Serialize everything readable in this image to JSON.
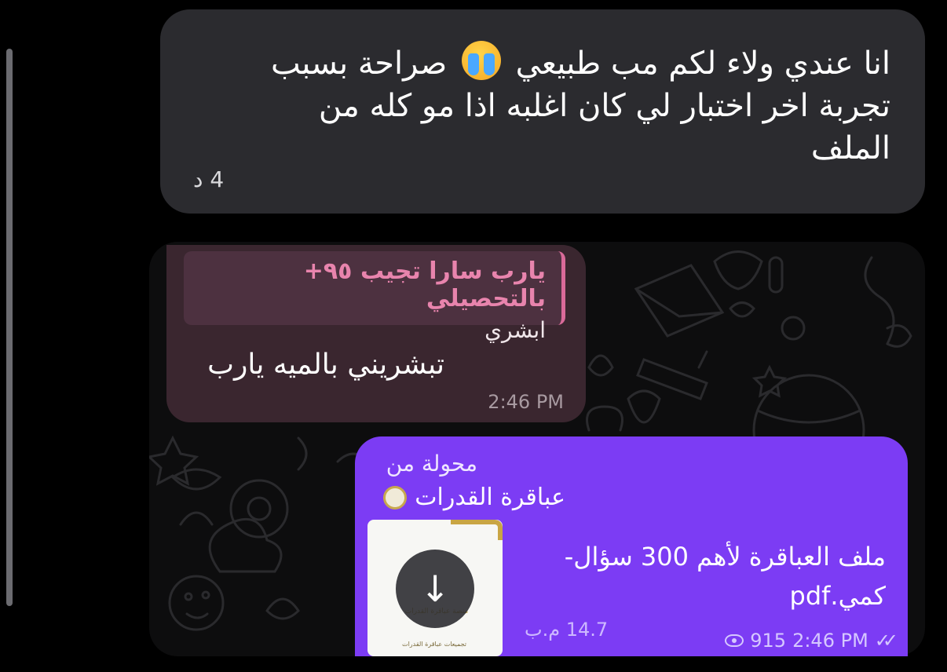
{
  "message_top": {
    "line1": "انا عندي ولاء لكم مب طبيعي",
    "line1_tail": "صراحة بسبب",
    "line2": "تجربة اخر اختبار لي كان اغلبه اذا مو كله من",
    "line3": "الملف",
    "emoji": "crying-face",
    "time": "4 د"
  },
  "reply_message": {
    "quote_title": "يارب سارا تجيب ٩٥+ بالتحصيلي",
    "quote_text": "ابشري",
    "text": "تبشريني بالميه يارب",
    "time": "2:46 PM",
    "accent": "#d96a99"
  },
  "forwarded_message": {
    "forward_label": "محولة من",
    "source_name": "عباقرة القدرات",
    "file_name": "ملف العباقرة لأهم 300 سؤال-كمي.pdf",
    "file_size": "14.7 م.ب",
    "views": "915",
    "time": "2:46 PM",
    "thumb_title": "منصة عباقرة القدرات",
    "thumb_footer": "تجميعات عباقرة القدرات",
    "accent": "#7c3cf4"
  }
}
